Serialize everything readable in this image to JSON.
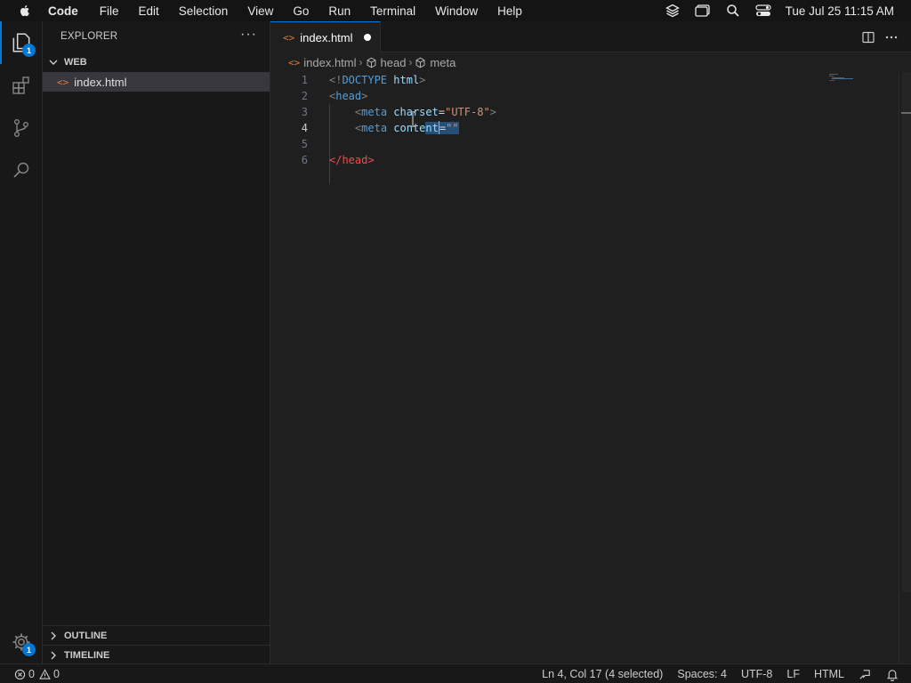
{
  "menubar": {
    "app_name": "Code",
    "menus": [
      "File",
      "Edit",
      "Selection",
      "View",
      "Go",
      "Run",
      "Terminal",
      "Window",
      "Help"
    ],
    "clock": "Tue Jul 25  11:15 AM"
  },
  "activity_bar": {
    "explorer_badge": "1",
    "settings_badge": "1"
  },
  "sidebar": {
    "title": "EXPLORER",
    "more": "···",
    "folder": "WEB",
    "files": [
      "index.html"
    ],
    "outline": "OUTLINE",
    "timeline": "TIMELINE"
  },
  "tab": {
    "icon": "<>",
    "label": "index.html"
  },
  "breadcrumbs": {
    "file": "index.html",
    "node1": "head",
    "node2": "meta"
  },
  "editor": {
    "line_numbers": [
      "1",
      "2",
      "3",
      "4",
      "5",
      "6"
    ],
    "current_line": 4
  },
  "statusbar": {
    "errors": "0",
    "warnings": "0",
    "position": "Ln 4, Col 17 (4 selected)",
    "spaces": "Spaces: 4",
    "encoding": "UTF-8",
    "eol": "LF",
    "language": "HTML"
  },
  "colors": {
    "accent": "#0078d4",
    "background": "#1f1f1f",
    "selection": "#264f78"
  }
}
